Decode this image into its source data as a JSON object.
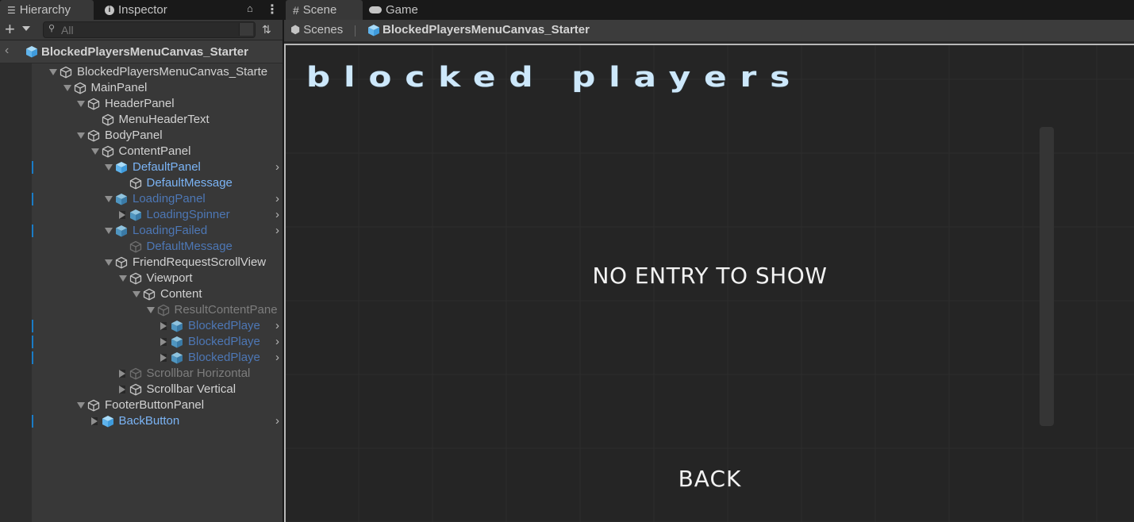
{
  "left_panel": {
    "tabs": [
      {
        "label": "Hierarchy",
        "icon": "list-icon",
        "active": true
      },
      {
        "label": "Inspector",
        "icon": "info-icon",
        "active": false
      }
    ],
    "search": {
      "placeholder": "All",
      "value": ""
    },
    "prefab_header": {
      "title": "BlockedPlayersMenuCanvas_Starter"
    },
    "tree": [
      {
        "label": "BlockedPlayersMenuCanvas_Starte",
        "depth": 0,
        "expand": "down",
        "icon": "gameobject",
        "style": "normal",
        "marked": false,
        "chevron": false
      },
      {
        "label": "MainPanel",
        "depth": 1,
        "expand": "down",
        "icon": "gameobject",
        "style": "normal",
        "marked": false,
        "chevron": false
      },
      {
        "label": "HeaderPanel",
        "depth": 2,
        "expand": "down",
        "icon": "gameobject",
        "style": "normal",
        "marked": false,
        "chevron": false
      },
      {
        "label": "MenuHeaderText",
        "depth": 3,
        "expand": "none",
        "icon": "gameobject",
        "style": "normal",
        "marked": false,
        "chevron": false
      },
      {
        "label": "BodyPanel",
        "depth": 2,
        "expand": "down",
        "icon": "gameobject",
        "style": "normal",
        "marked": false,
        "chevron": false
      },
      {
        "label": "ContentPanel",
        "depth": 3,
        "expand": "down",
        "icon": "gameobject",
        "style": "normal",
        "marked": false,
        "chevron": false
      },
      {
        "label": "DefaultPanel",
        "depth": 4,
        "expand": "down",
        "icon": "prefab",
        "style": "prefab",
        "marked": true,
        "chevron": true
      },
      {
        "label": "DefaultMessage",
        "depth": 5,
        "expand": "none",
        "icon": "gameobject",
        "style": "prefab",
        "marked": false,
        "chevron": false
      },
      {
        "label": "LoadingPanel",
        "depth": 4,
        "expand": "down",
        "icon": "prefab-dim",
        "style": "prefab-dim",
        "marked": true,
        "chevron": true
      },
      {
        "label": "LoadingSpinner",
        "depth": 5,
        "expand": "right",
        "icon": "prefab-dim",
        "style": "prefab-dim",
        "marked": false,
        "chevron": true
      },
      {
        "label": "LoadingFailed",
        "depth": 4,
        "expand": "down",
        "icon": "prefab-dim",
        "style": "prefab-dim",
        "marked": true,
        "chevron": true
      },
      {
        "label": "DefaultMessage",
        "depth": 5,
        "expand": "none",
        "icon": "gameobject-dim",
        "style": "prefab-dim",
        "marked": false,
        "chevron": false
      },
      {
        "label": "FriendRequestScrollView",
        "depth": 4,
        "expand": "down",
        "icon": "gameobject",
        "style": "normal",
        "marked": false,
        "chevron": false
      },
      {
        "label": "Viewport",
        "depth": 5,
        "expand": "down",
        "icon": "gameobject",
        "style": "normal",
        "marked": false,
        "chevron": false
      },
      {
        "label": "Content",
        "depth": 6,
        "expand": "down",
        "icon": "gameobject",
        "style": "normal",
        "marked": false,
        "chevron": false
      },
      {
        "label": "ResultContentPane",
        "depth": 7,
        "expand": "down",
        "icon": "gameobject-dim",
        "style": "dim",
        "marked": false,
        "chevron": false
      },
      {
        "label": "BlockedPlaye",
        "depth": 8,
        "expand": "right",
        "icon": "prefab-dim",
        "style": "prefab-dim",
        "marked": true,
        "chevron": true
      },
      {
        "label": "BlockedPlaye",
        "depth": 8,
        "expand": "right",
        "icon": "prefab-dim",
        "style": "prefab-dim",
        "marked": true,
        "chevron": true
      },
      {
        "label": "BlockedPlaye",
        "depth": 8,
        "expand": "right",
        "icon": "prefab-dim",
        "style": "prefab-dim",
        "marked": true,
        "chevron": true
      },
      {
        "label": "Scrollbar Horizontal",
        "depth": 5,
        "expand": "right",
        "icon": "gameobject-dim",
        "style": "dim",
        "marked": false,
        "chevron": false
      },
      {
        "label": "Scrollbar Vertical",
        "depth": 5,
        "expand": "right",
        "icon": "gameobject",
        "style": "normal",
        "marked": false,
        "chevron": false
      },
      {
        "label": "FooterButtonPanel",
        "depth": 2,
        "expand": "down",
        "icon": "gameobject",
        "style": "normal",
        "marked": false,
        "chevron": false
      },
      {
        "label": "BackButton",
        "depth": 3,
        "expand": "right",
        "icon": "prefab",
        "style": "prefab",
        "marked": true,
        "chevron": true
      }
    ]
  },
  "right_panel": {
    "tabs": [
      {
        "label": "Scene",
        "icon": "grid-icon",
        "active": true
      },
      {
        "label": "Game",
        "icon": "gamepad-icon",
        "active": false
      }
    ],
    "breadcrumb": [
      {
        "label": "Scenes",
        "icon": "unity-icon"
      },
      {
        "label": "BlockedPlayersMenuCanvas_Starter",
        "icon": "prefab-icon"
      }
    ],
    "scene": {
      "header_text": "Blocked Players",
      "empty_message": "NO ENTRY TO SHOW",
      "back_button": "BACK"
    }
  },
  "colors": {
    "prefab_blue": "#7bb4f5",
    "prefab_blue_dim": "#4d77b5",
    "selection_marker": "#1a7cc6",
    "header_text": "#cde8fb"
  }
}
